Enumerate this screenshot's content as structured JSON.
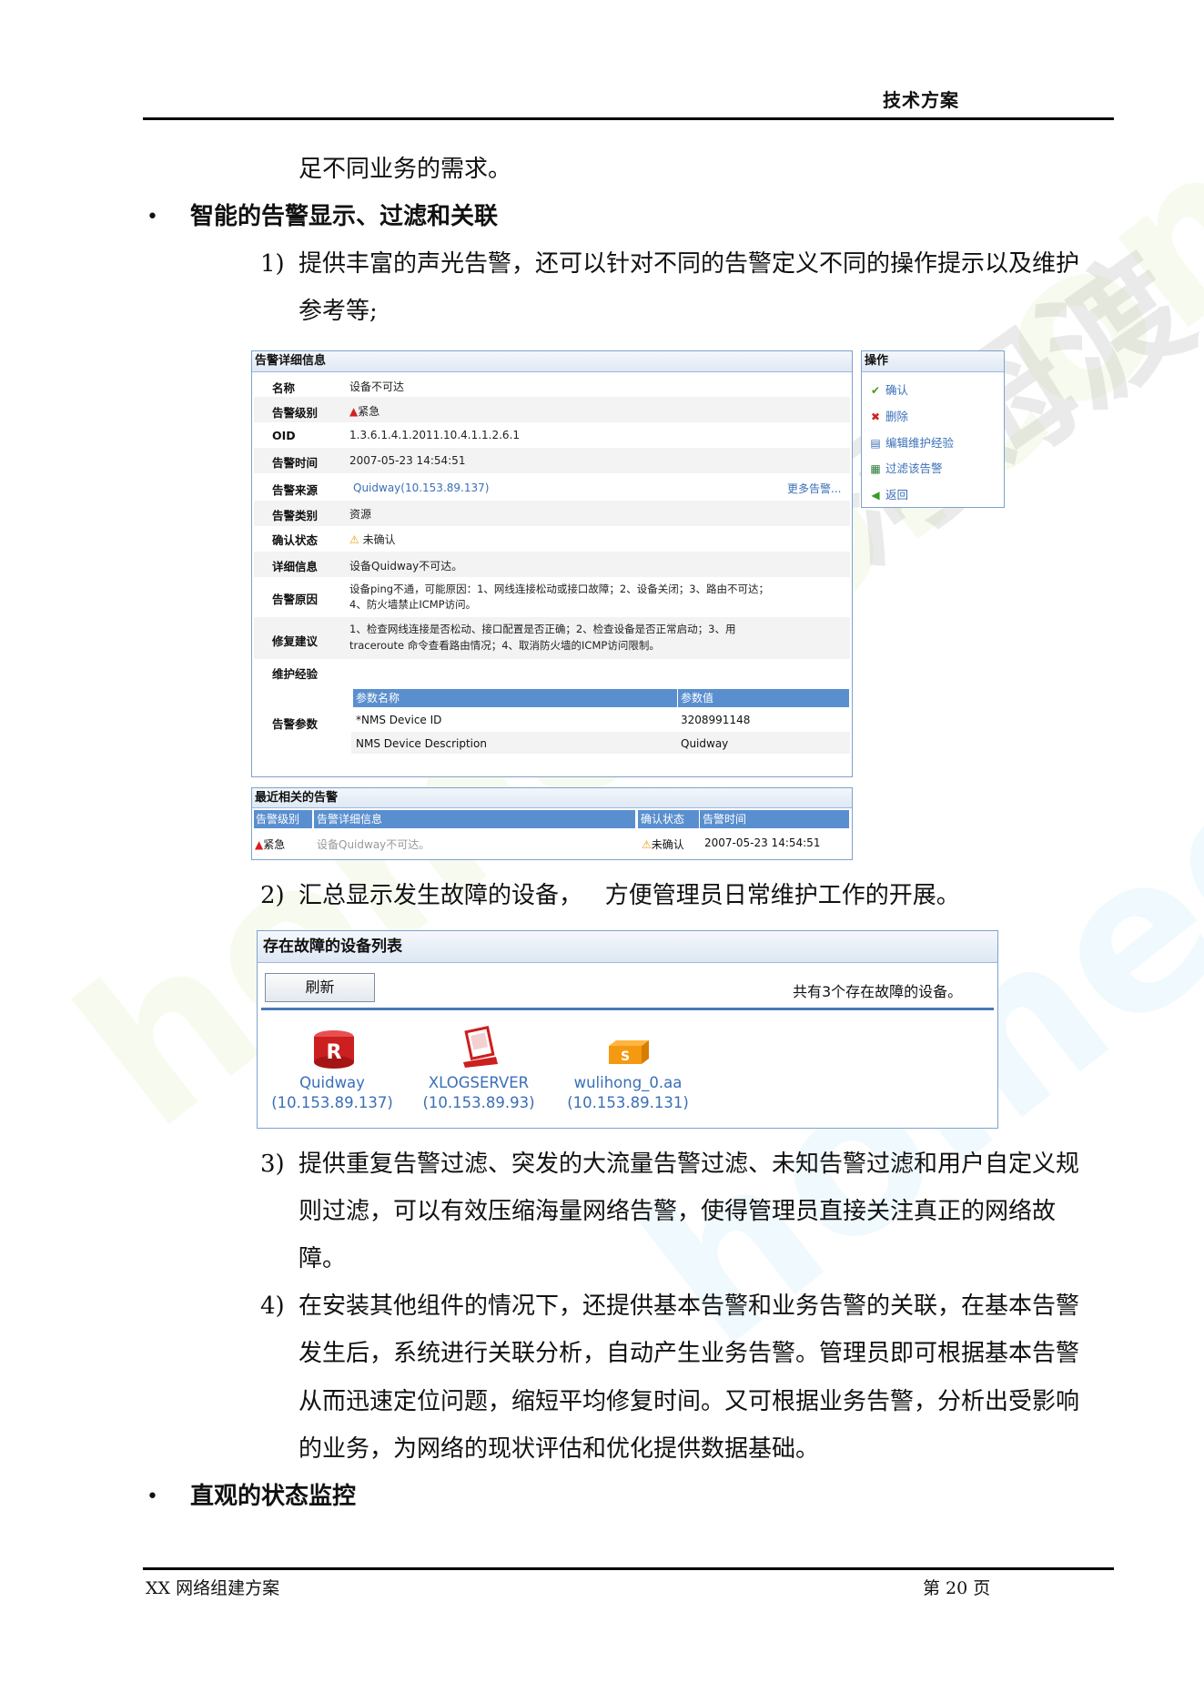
{
  "header": {
    "title": "技术方案"
  },
  "footer": {
    "left": "XX 网络组建方案",
    "page": "第 20 页"
  },
  "body": {
    "line0": "足不同业务的需求。",
    "bullet1": "智能的告警显示、过滤和关联",
    "item1_num": "1)",
    "item1_l1": "提供丰富的声光告警，还可以针对不同的告警定义不同的操作提示以及维护",
    "item1_l2": "参考等;",
    "item2_num": "2)",
    "item2_l1": "汇总显示发生故障的设备，   方便管理员日常维护工作的开展。",
    "item3_num": "3)",
    "item3_l1": "提供重复告警过滤、突发的大流量告警过滤、未知告警过滤和用户自定义规",
    "item3_l2": "则过滤，可以有效压缩海量网络告警，使得管理员直接关注真正的网络故",
    "item3_l3": "障。",
    "item4_num": "4)",
    "item4_l1": "在安装其他组件的情况下，还提供基本告警和业务告警的关联，在基本告警",
    "item4_l2": "发生后，系统进行关联分析，自动产生业务告警。管理员即可根据基本告警",
    "item4_l3": "从而迅速定位问题，缩短平均修复时间。又可根据业务告警，分析出受影响",
    "item4_l4": "的业务，为网络的现状评估和优化提供数据基础。",
    "bullet2": "直观的状态监控"
  },
  "alarm_detail": {
    "title": "告警详细信息",
    "rows": [
      {
        "label": "名称",
        "value": "设备不可达"
      },
      {
        "label": "告警级别",
        "value": "紧急"
      },
      {
        "label": "OID",
        "value": "1.3.6.1.4.1.2011.10.4.1.1.2.6.1"
      },
      {
        "label": "告警时间",
        "value": "2007-05-23 14:54:51"
      },
      {
        "label": "告警来源",
        "value": "Quidway(10.153.89.137)",
        "extra": "更多告警..."
      },
      {
        "label": "告警类别",
        "value": "资源"
      },
      {
        "label": "确认状态",
        "value": "未确认"
      },
      {
        "label": "详细信息",
        "value": "设备Quidway不可达。"
      },
      {
        "label": "告警原因",
        "value": "设备ping不通，可能原因：1、网线连接松动或接口故障；2、设备关闭；3、路由不可达；",
        "value2": "4、防火墙禁止ICMP访问。"
      },
      {
        "label": "修复建议",
        "value": "1、检查网线连接是否松动、接口配置是否正确；2、检查设备是否正常启动；3、用",
        "value2": "traceroute 命令查看路由情况；4、取消防火墙的ICMP访问限制。"
      },
      {
        "label": "维护经验",
        "value": ""
      },
      {
        "label": "告警参数",
        "value": ""
      }
    ],
    "params": {
      "headers": [
        "参数名称",
        "参数值"
      ],
      "rows": [
        [
          "*NMS Device ID",
          "3208991148"
        ],
        [
          "NMS Device Description",
          "Quidway"
        ]
      ]
    }
  },
  "operations": {
    "title": "操作",
    "items": [
      "确认",
      "删除",
      "编辑维护经验",
      "过滤该告警",
      "返回"
    ]
  },
  "recent": {
    "title": "最近相关的告警",
    "headers": [
      "告警级别",
      "告警详细信息",
      "确认状态",
      "告警时间"
    ],
    "row": [
      "紧急",
      "设备Quidway不可达。",
      "未确认",
      "2007-05-23 14:54:51"
    ]
  },
  "devices": {
    "title": "存在故障的设备列表",
    "refresh": "刷新",
    "summary": "共有3个存在故障的设备。",
    "items": [
      {
        "name": "Quidway",
        "ip": "(10.153.89.137)",
        "icon": "router-icon"
      },
      {
        "name": "XLOGSERVER",
        "ip": "(10.153.89.93)",
        "icon": "server-icon"
      },
      {
        "name": "wulihong_0.aa",
        "ip": "(10.153.89.131)",
        "icon": "switch-icon"
      }
    ]
  },
  "colors": {
    "panel_border": "#7da2ce",
    "grid_header": "#5a8fcf",
    "link": "#3a6fb8",
    "critical": "#d42020"
  }
}
